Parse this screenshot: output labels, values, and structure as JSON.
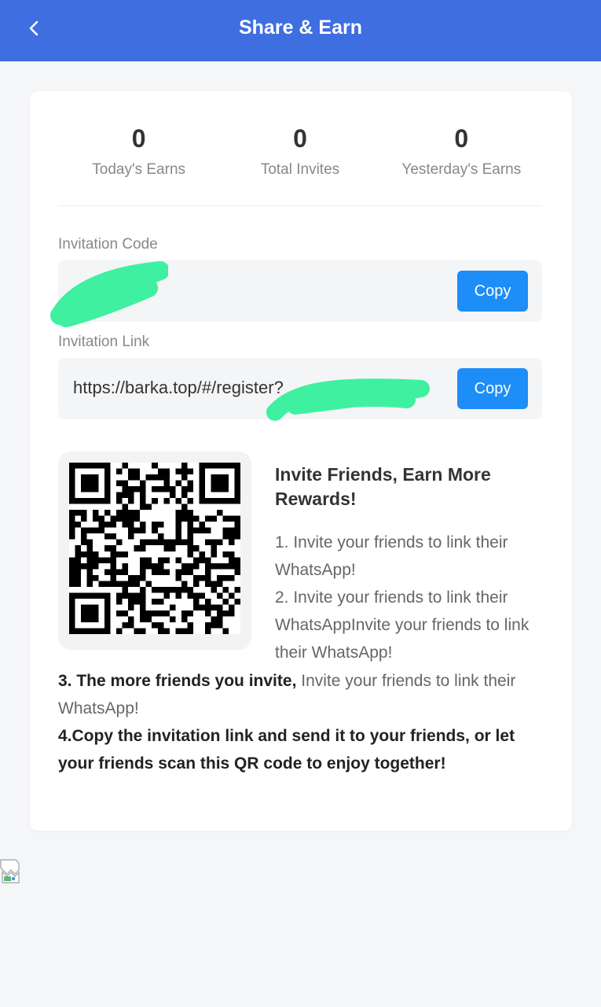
{
  "header": {
    "title": "Share & Earn",
    "back_icon": "chevron-left-icon",
    "bg_color": "#3f6ee0"
  },
  "stats": [
    {
      "value": "0",
      "label": "Today's Earns"
    },
    {
      "value": "0",
      "label": "Total Invites"
    },
    {
      "value": "0",
      "label": "Yesterday's Earns"
    }
  ],
  "invitation_code": {
    "label": "Invitation Code",
    "value": "",
    "copy_label": "Copy"
  },
  "invitation_link": {
    "label": "Invitation Link",
    "value": "https://barka.top/#/register?",
    "copy_label": "Copy"
  },
  "invite": {
    "title": "Invite Friends, Earn More Rewards!",
    "step1": "1. Invite your friends to link their WhatsApp!",
    "step2": "2. Invite your friends to link their WhatsAppInvite your friends to link their WhatsApp!",
    "step3_bold": "3. The more friends you invite,",
    "step3_rest": " Invite your friends to link their WhatsApp!",
    "step4": "4.Copy the invitation link and send it to your friends, or let your friends scan this QR code to enjoy together!"
  },
  "colors": {
    "accent": "#1d8df7",
    "redaction": "#3ff0a0"
  }
}
